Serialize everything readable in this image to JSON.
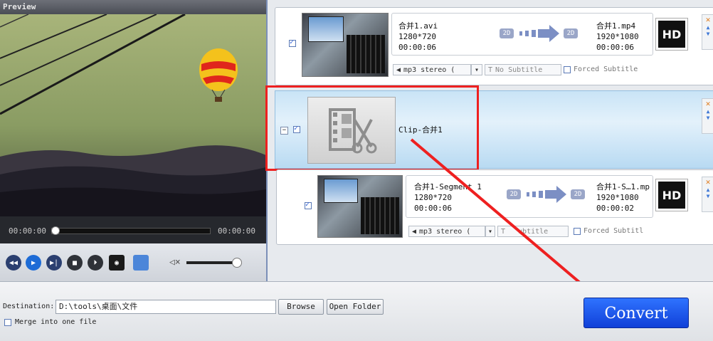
{
  "preview": {
    "title": "Preview",
    "time_current": "00:00:00",
    "time_total": "00:00:00"
  },
  "items": [
    {
      "source_name": "合并1.avi",
      "source_res": "1280*720",
      "source_dur": "00:00:06",
      "mode_in": "2D",
      "mode_out": "2D",
      "target_name": "合并1.mp4",
      "target_res": "1920*1080",
      "target_dur": "00:00:06",
      "quality": "HD",
      "audio": "mp3 stereo (",
      "subtitle": "No Subtitle",
      "forced_subtitle": "Forced Subtitle"
    }
  ],
  "clip": {
    "label": "Clip-合并1"
  },
  "segment": {
    "source_name": "合并1-Segment 1",
    "source_res": "1280*720",
    "source_dur": "00:00:06",
    "mode_in": "2D",
    "mode_out": "2D",
    "target_name": "合并1-S…1.mp",
    "target_res": "1920*1080",
    "target_dur": "00:00:02",
    "quality": "HD",
    "audio": "mp3 stereo (",
    "subtitle": "ubtitle",
    "forced_subtitle": "Forced Subtitl"
  },
  "bottom": {
    "destination_label": "Destination:",
    "destination_value": "D:\\tools\\桌面\\文件",
    "browse_label": "Browse",
    "open_folder_label": "Open Folder",
    "merge_label": "Merge into one file",
    "convert_label": "Convert"
  },
  "colors": {
    "highlight_red": "#ee2020",
    "convert_blue": "#1f5af0",
    "selected_row": "#c9e4f6"
  }
}
